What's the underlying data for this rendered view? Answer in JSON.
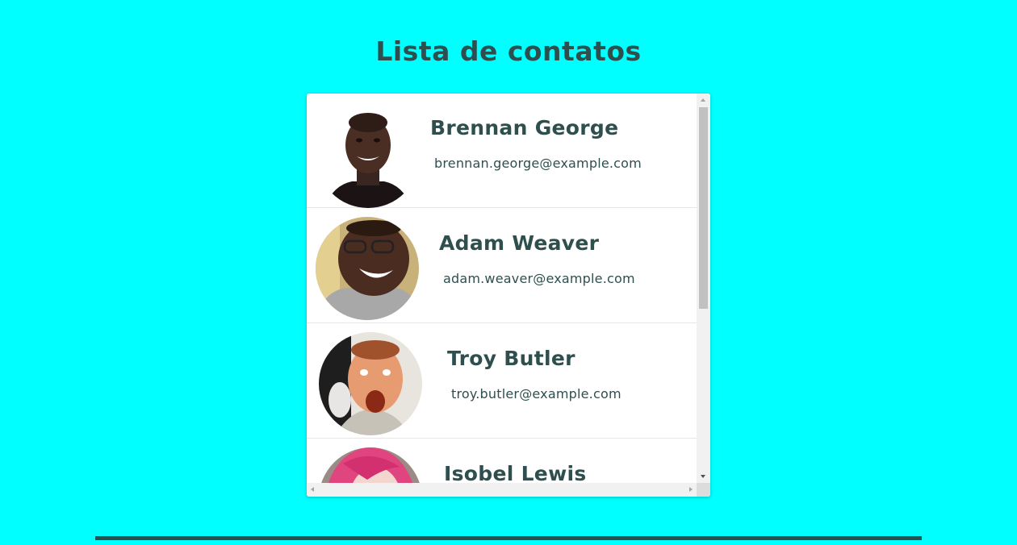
{
  "page": {
    "title": "Lista de contatos",
    "background": "#00ffff",
    "text_color": "#2f4f4f"
  },
  "contacts": [
    {
      "name": "Brennan George",
      "email": "brennan.george@example.com",
      "avatar": "photo-avatar"
    },
    {
      "name": "Adam Weaver",
      "email": "adam.weaver@example.com",
      "avatar": "photo-avatar"
    },
    {
      "name": "Troy Butler",
      "email": "troy.butler@example.com",
      "avatar": "photo-avatar"
    },
    {
      "name": "Isobel Lewis",
      "email": "",
      "avatar": "photo-avatar"
    }
  ],
  "icons": {
    "scroll_up": "scroll-up-arrow-icon",
    "scroll_down": "scroll-down-arrow-icon",
    "scroll_left": "scroll-left-arrow-icon",
    "scroll_right": "scroll-right-arrow-icon"
  }
}
